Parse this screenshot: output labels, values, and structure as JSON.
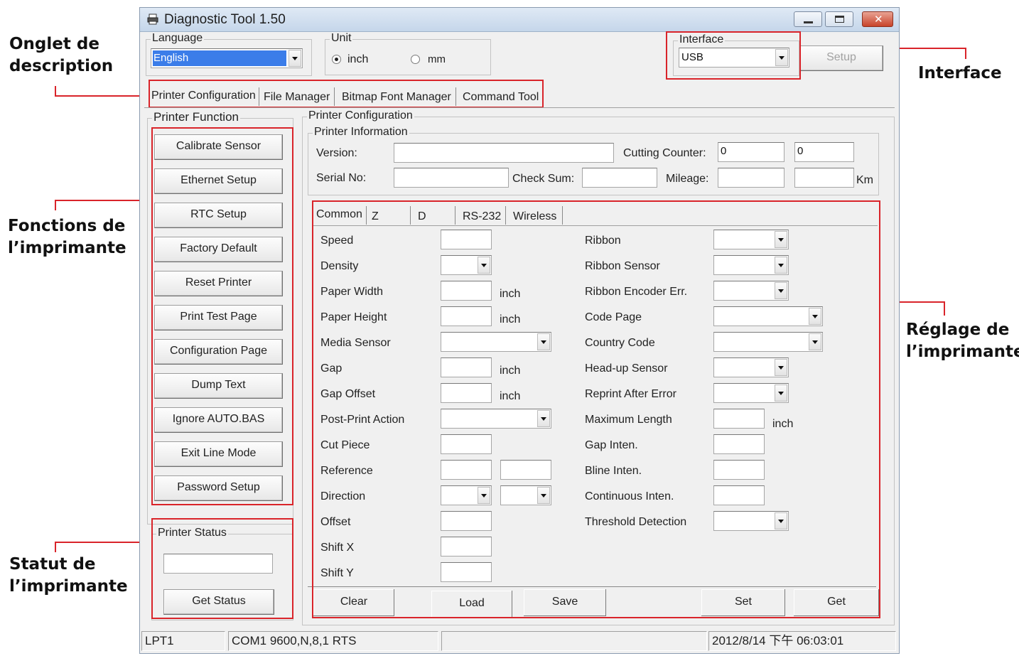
{
  "window": {
    "title": "Diagnostic Tool 1.50"
  },
  "language": {
    "label": "Language",
    "value": "English"
  },
  "unit": {
    "label": "Unit",
    "options": [
      "inch",
      "mm"
    ],
    "selected": "inch"
  },
  "interface": {
    "label": "Interface",
    "value": "USB",
    "setup_label": "Setup"
  },
  "main_tabs": [
    "Printer Configuration",
    "File Manager",
    "Bitmap Font Manager",
    "Command Tool"
  ],
  "printer_function": {
    "label": "Printer Function",
    "buttons": [
      "Calibrate Sensor",
      "Ethernet Setup",
      "RTC Setup",
      "Factory Default",
      "Reset Printer",
      "Print Test Page",
      "Configuration Page",
      "Dump Text",
      "Ignore AUTO.BAS",
      "Exit Line Mode",
      "Password Setup"
    ]
  },
  "printer_status": {
    "label": "Printer Status",
    "value": "",
    "get_status_label": "Get Status"
  },
  "printer_configuration": {
    "label": "Printer Configuration",
    "info": {
      "label": "Printer Information",
      "version_label": "Version:",
      "version": "",
      "serial_label": "Serial No:",
      "serial": "",
      "checksum_label": "Check Sum:",
      "checksum": "",
      "cutting_counter_label": "Cutting Counter:",
      "cutting_counter_1": "0",
      "cutting_counter_2": "0",
      "mileage_label": "Mileage:",
      "mileage_1": "",
      "mileage_2": "",
      "mileage_unit": "Km"
    },
    "sub_tabs": [
      "Common",
      "Z",
      "D",
      "RS-232",
      "Wireless"
    ],
    "left_fields": {
      "speed": "Speed",
      "density": "Density",
      "paper_width": "Paper Width",
      "paper_height": "Paper Height",
      "media_sensor": "Media Sensor",
      "gap": "Gap",
      "gap_offset": "Gap Offset",
      "post_print_action": "Post-Print Action",
      "cut_piece": "Cut Piece",
      "reference": "Reference",
      "direction": "Direction",
      "offset": "Offset",
      "shift_x": "Shift X",
      "shift_y": "Shift Y"
    },
    "right_fields": {
      "ribbon": "Ribbon",
      "ribbon_sensor": "Ribbon Sensor",
      "ribbon_encoder_err": "Ribbon Encoder Err.",
      "code_page": "Code Page",
      "country_code": "Country Code",
      "head_up_sensor": "Head-up Sensor",
      "reprint_after_error": "Reprint After Error",
      "maximum_length": "Maximum Length",
      "gap_inten": "Gap Inten.",
      "bline_inten": "Bline Inten.",
      "continuous_inten": "Continuous Inten.",
      "threshold_detection": "Threshold Detection"
    },
    "unit_inch": "inch",
    "bottom_buttons": {
      "clear": "Clear",
      "load": "Load",
      "save": "Save",
      "set": "Set",
      "get": "Get"
    }
  },
  "status_bar": {
    "port": "LPT1",
    "com": "COM1 9600,N,8,1 RTS",
    "middle": "",
    "datetime": "2012/8/14 下午 06:03:01"
  },
  "annotations": {
    "tab_description": "Onglet de\ndescription",
    "interface": "Interface",
    "printer_functions": "Fonctions de\nl’imprimante",
    "printer_settings": "Réglage de\nl’imprimante",
    "printer_status": "Statut de\nl’imprimante"
  },
  "colors": {
    "annotation_red": "#d9242a",
    "title_bar": "#c5d6ea",
    "selection_blue": "#3b7de9"
  }
}
